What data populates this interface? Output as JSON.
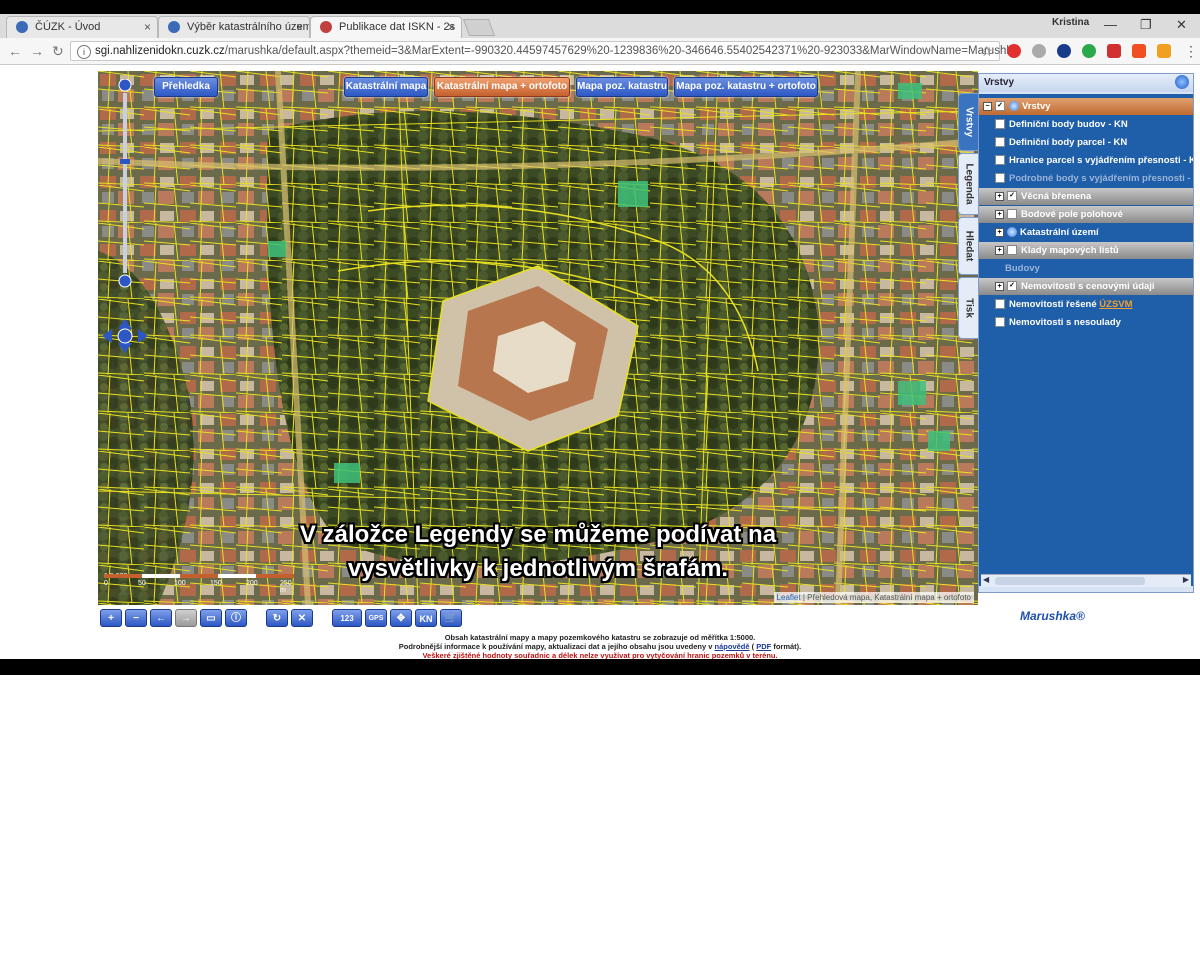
{
  "browser": {
    "tabs": [
      {
        "label": "ČÚZK - Úvod",
        "active": false
      },
      {
        "label": "Výběr katastrálního územ",
        "active": false
      },
      {
        "label": "Publikace dat ISKN - 2s",
        "active": true
      }
    ],
    "user_label": "Kristina",
    "url_host": "sgi.nahlizenidokn.cuzk.cz",
    "url_rest": "/marushka/default.aspx?themeid=3&MarExtent=-990320.44597457629%20-1239836%20-346646.55402542371%20-923033&MarWindowName=Marushka"
  },
  "map": {
    "overview_label": "Přehledka",
    "layer_buttons": [
      "Katastrální mapa",
      "Katastrální mapa + ortofoto",
      "Mapa poz. katastru",
      "Mapa poz. katastru + ortofoto"
    ],
    "active_layer_index": 1,
    "scale_label": "1:5 000",
    "scale_ticks": [
      "0",
      "50",
      "100",
      "150",
      "200",
      "250 m"
    ],
    "attribution_link": "Leaflet",
    "attribution_text": "| Přehledová mapa, Katastrální mapa + ortofoto",
    "caption_line1": "V záložce Legendy se můžeme podívat na",
    "caption_line2": "vysvětlivky k jednotlivým šrafám."
  },
  "sidepanel": {
    "title": "Vrstvy",
    "vtabs": [
      "Vrstvy",
      "Legenda",
      "Hledat",
      "Tisk"
    ],
    "active_vtab": 0,
    "items": [
      {
        "label": "Vrstvy",
        "kind": "top",
        "checked": true
      },
      {
        "label": "Definiční body budov - KN",
        "kind": "item"
      },
      {
        "label": "Definiční body parcel - KN",
        "kind": "item"
      },
      {
        "label": "Hranice parcel s vyjádřením přesnosti - K",
        "kind": "item"
      },
      {
        "label": "Podrobné body s vyjádřením přesnosti - K",
        "kind": "dim"
      },
      {
        "label": "Věcná břemena",
        "kind": "group",
        "checked": true
      },
      {
        "label": "Bodové pole polohové",
        "kind": "group"
      },
      {
        "label": "Katastrální území",
        "kind": "item-icon"
      },
      {
        "label": "Klady mapových listů",
        "kind": "group"
      },
      {
        "label": "Budovy",
        "kind": "dim-noexp"
      },
      {
        "label": "Nemovitosti s cenovými údaji",
        "kind": "group",
        "checked": true
      },
      {
        "label": "Nemovitosti řešené",
        "kind": "item-link",
        "link": "ÚZSVM"
      },
      {
        "label": "Nemovitosti s nesoulady",
        "kind": "item"
      }
    ]
  },
  "toolbar": {
    "buttons": [
      "+",
      "−",
      "←",
      "→",
      "▭",
      "ⓘ",
      "↻",
      "✕",
      "123",
      "GPS",
      "✥",
      "KN",
      "🛒"
    ]
  },
  "logo": "Marushka®",
  "footer": {
    "line1": "Obsah katastrální mapy a mapy pozemkového katastru se zobrazuje od měřítka 1:5000.",
    "line2_pre": "Podrobnější informace k používání mapy, aktualizaci dat a jejího obsahu jsou uvedeny v",
    "line2_link1": "nápovědě",
    "line2_mid": "(",
    "line2_link2": "PDF",
    "line2_post": "formát).",
    "line3": "Veškeré zjištěné hodnoty souřadnic a délek nelze využívat pro vytyčování hranic pozemků v terénu."
  }
}
